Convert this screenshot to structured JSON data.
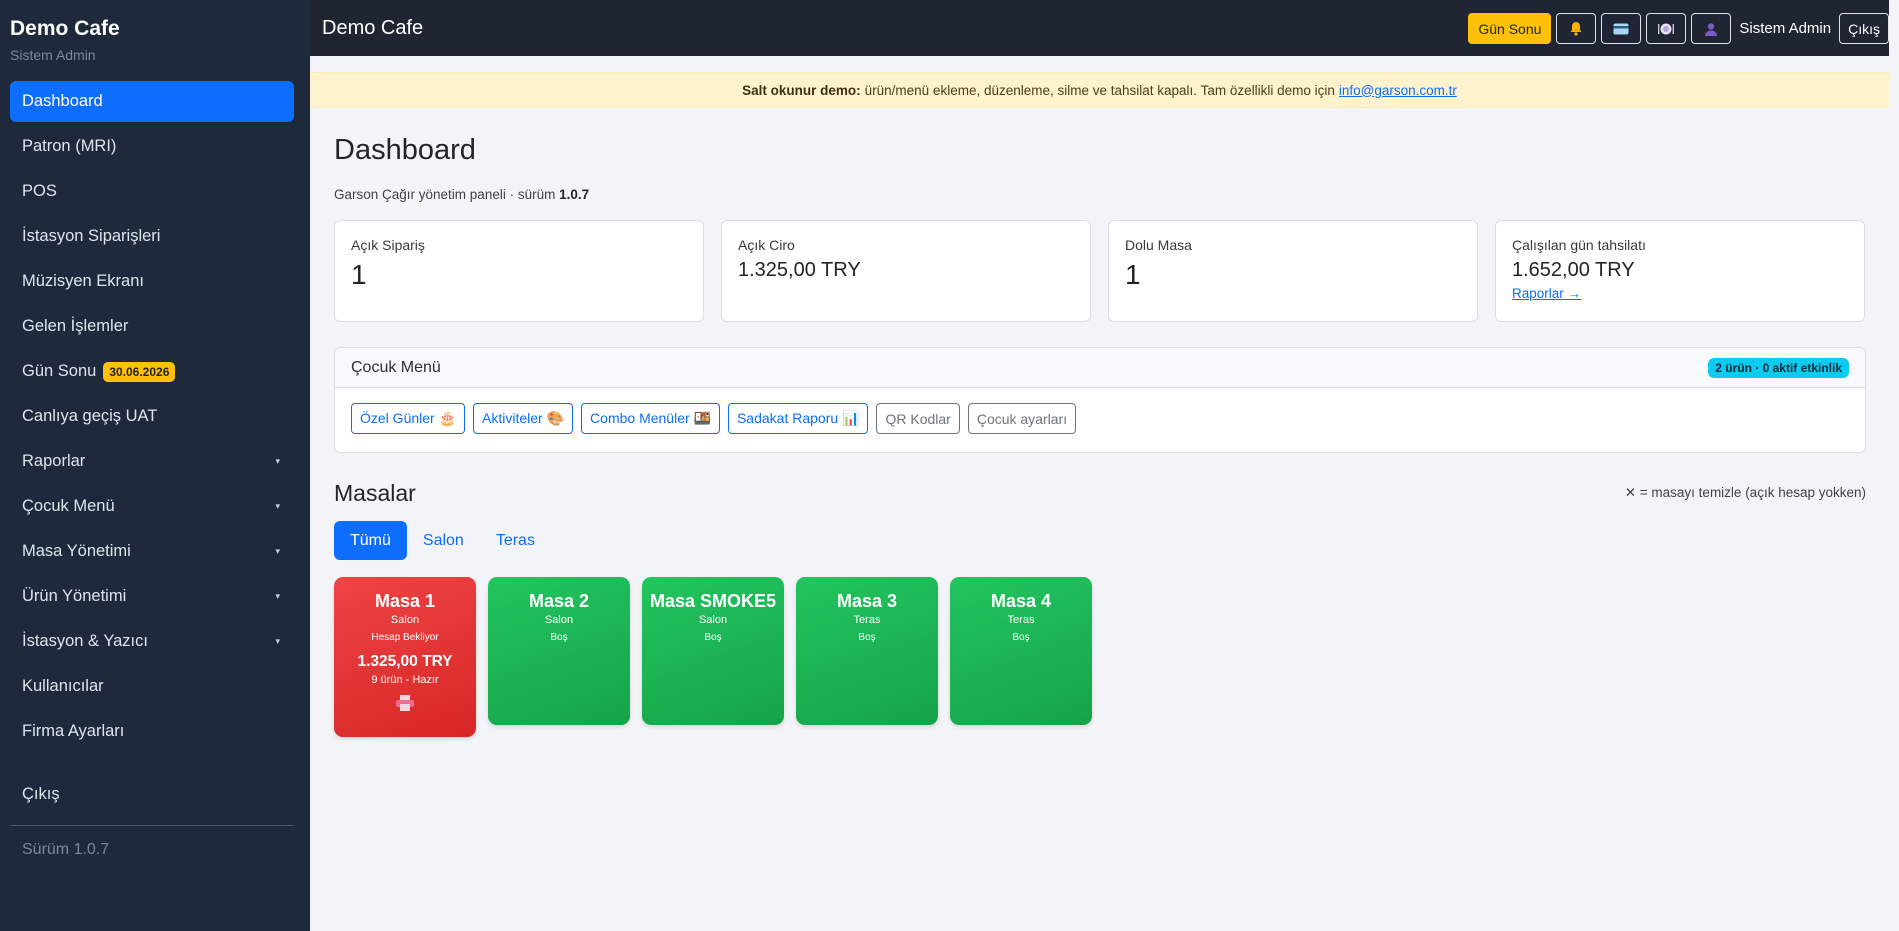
{
  "sidebar": {
    "brand_title": "Demo Cafe",
    "brand_sub": "Sistem Admin",
    "items": [
      {
        "label": "Dashboard",
        "active": true
      },
      {
        "label": "Patron (MRI)"
      },
      {
        "label": "POS"
      },
      {
        "label": "İstasyon Siparişleri"
      },
      {
        "label": "Müzisyen Ekranı"
      },
      {
        "label": "Gelen İşlemler"
      },
      {
        "label": "Gün Sonu",
        "badge": "30.06.2026"
      },
      {
        "label": "Canlıya geçiş UAT"
      },
      {
        "label": "Raporlar",
        "caret": "▾"
      },
      {
        "label": "Çocuk Menü",
        "caret": "▾"
      },
      {
        "label": "Masa Yönetimi",
        "caret": "▾"
      },
      {
        "label": "Ürün Yönetimi",
        "caret": "▾"
      },
      {
        "label": "İstasyon & Yazıcı",
        "caret": "▾"
      },
      {
        "label": "Kullanıcılar"
      },
      {
        "label": "Firma Ayarları"
      }
    ],
    "exit_label": "Çıkış",
    "version": "Sürüm 1.0.7"
  },
  "topbar": {
    "title": "Demo Cafe",
    "gun_sonu_label": "Gün Sonu",
    "icons": [
      "bell-icon",
      "card-icon",
      "plate-icon",
      "user-icon"
    ],
    "user_name": "Sistem Admin",
    "logout_label": "Çıkış"
  },
  "alert": {
    "bold": "Salt okunur demo:",
    "text": "ürün/menü ekleme, düzenleme, silme ve tahsilat kapalı. Tam özellikli demo için",
    "link": "info@garson.com.tr"
  },
  "page": {
    "title": "Dashboard",
    "sub_prefix": "Garson Çağır yönetim paneli · sürüm",
    "sub_version": "1.0.7"
  },
  "stats": [
    {
      "label": "Açık Sipariş",
      "value": "1"
    },
    {
      "label": "Açık Ciro",
      "value": "1.325,00 TRY"
    },
    {
      "label": "Dolu Masa",
      "value": "1"
    },
    {
      "label": "Çalışılan gün tahsilatı",
      "value": "1.652,00 TRY",
      "link": "Raporlar →"
    }
  ],
  "kids_menu": {
    "title": "Çocuk Menü",
    "badge": "2 ürün · 0 aktif etkinlik",
    "buttons": [
      "Özel Günler 🎂",
      "Aktiviteler 🎨",
      "Combo Menüler 🍱",
      "Sadakat Raporu 📊"
    ],
    "secondary_buttons": [
      "QR Kodlar",
      "Çocuk ayarları"
    ]
  },
  "tables": {
    "title": "Masalar",
    "hint": "✕ = masayı temizle (açık hesap yokken)",
    "tabs": [
      "Tümü",
      "Salon",
      "Teras"
    ],
    "items": [
      {
        "name": "Masa 1",
        "zone": "Salon",
        "status": "Hesap Bekliyor",
        "amount": "1.325,00 TRY",
        "items": "9 ürün - Hazır",
        "busy": true
      },
      {
        "name": "Masa 2",
        "zone": "Salon",
        "status": "Boş"
      },
      {
        "name": "Masa SMOKE5",
        "zone": "Salon",
        "status": "Boş"
      },
      {
        "name": "Masa 3",
        "zone": "Teras",
        "status": "Boş"
      },
      {
        "name": "Masa 4",
        "zone": "Teras",
        "status": "Boş"
      }
    ]
  },
  "colors": {
    "sidebar_bg": "#1e2a3b",
    "primary": "#0d6efd",
    "warning": "#ffc107",
    "busy": "#ef4444",
    "free": "#22c55e",
    "info": "#0dcaf0"
  }
}
